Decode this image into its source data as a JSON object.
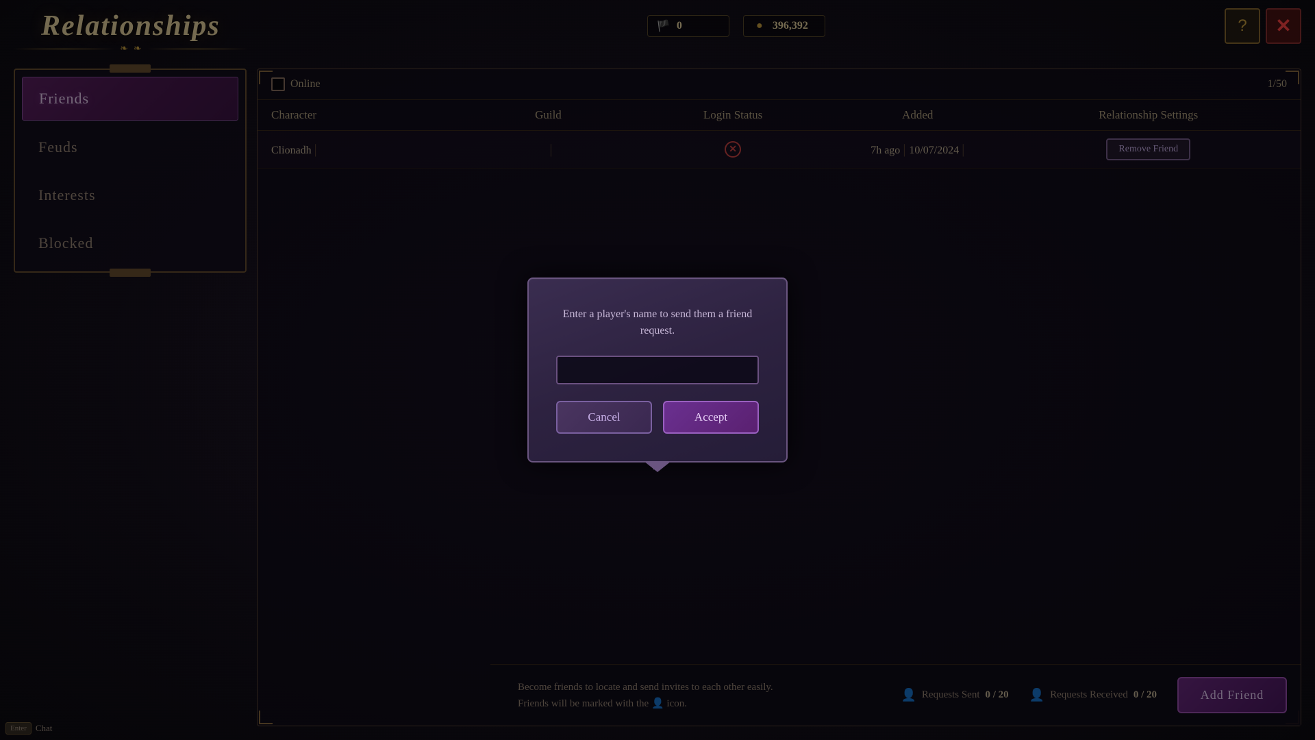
{
  "header": {
    "title": "Relationships",
    "title_ornament": "❧",
    "currency": [
      {
        "id": "currency1",
        "icon": "🏴",
        "value": "0"
      },
      {
        "id": "currency2",
        "icon": "●",
        "value": "396,392"
      }
    ],
    "help_label": "?",
    "close_label": "✕"
  },
  "sidebar": {
    "items": [
      {
        "id": "friends",
        "label": "Friends",
        "active": true
      },
      {
        "id": "feuds",
        "label": "Feuds",
        "active": false
      },
      {
        "id": "interests",
        "label": "Interests",
        "active": false
      },
      {
        "id": "blocked",
        "label": "Blocked",
        "active": false
      }
    ]
  },
  "main": {
    "filter": {
      "online_label": "Online",
      "checked": false
    },
    "page_count": "1/50",
    "table": {
      "headers": [
        {
          "id": "character",
          "label": "Character"
        },
        {
          "id": "guild",
          "label": "Guild"
        },
        {
          "id": "login_status",
          "label": "Login Status"
        },
        {
          "id": "added",
          "label": "Added"
        },
        {
          "id": "relationship_settings",
          "label": "Relationship Settings"
        }
      ],
      "rows": [
        {
          "character": "Clionadh",
          "guild": "",
          "login_status_icon": "✕",
          "login_status_offline": true,
          "added": "7h ago",
          "date": "10/07/2024",
          "action_label": "Remove Friend"
        }
      ]
    },
    "bottom": {
      "info_line1": "Become friends to locate and send invites to each other easily.",
      "info_line2": "Friends will be marked with the 👤 icon.",
      "requests_sent_label": "Requests Sent",
      "requests_sent_value": "0 / 20",
      "requests_received_label": "Requests Received",
      "requests_received_value": "0 / 20",
      "add_friend_label": "Add Friend"
    }
  },
  "modal": {
    "visible": true,
    "prompt_text": "Enter a player's name to send them a friend request.",
    "input_placeholder": "",
    "cancel_label": "Cancel",
    "accept_label": "Accept",
    "bottom_ornament": "❧"
  },
  "footer": {
    "enter_key": "Enter",
    "chat_label": "Chat"
  }
}
